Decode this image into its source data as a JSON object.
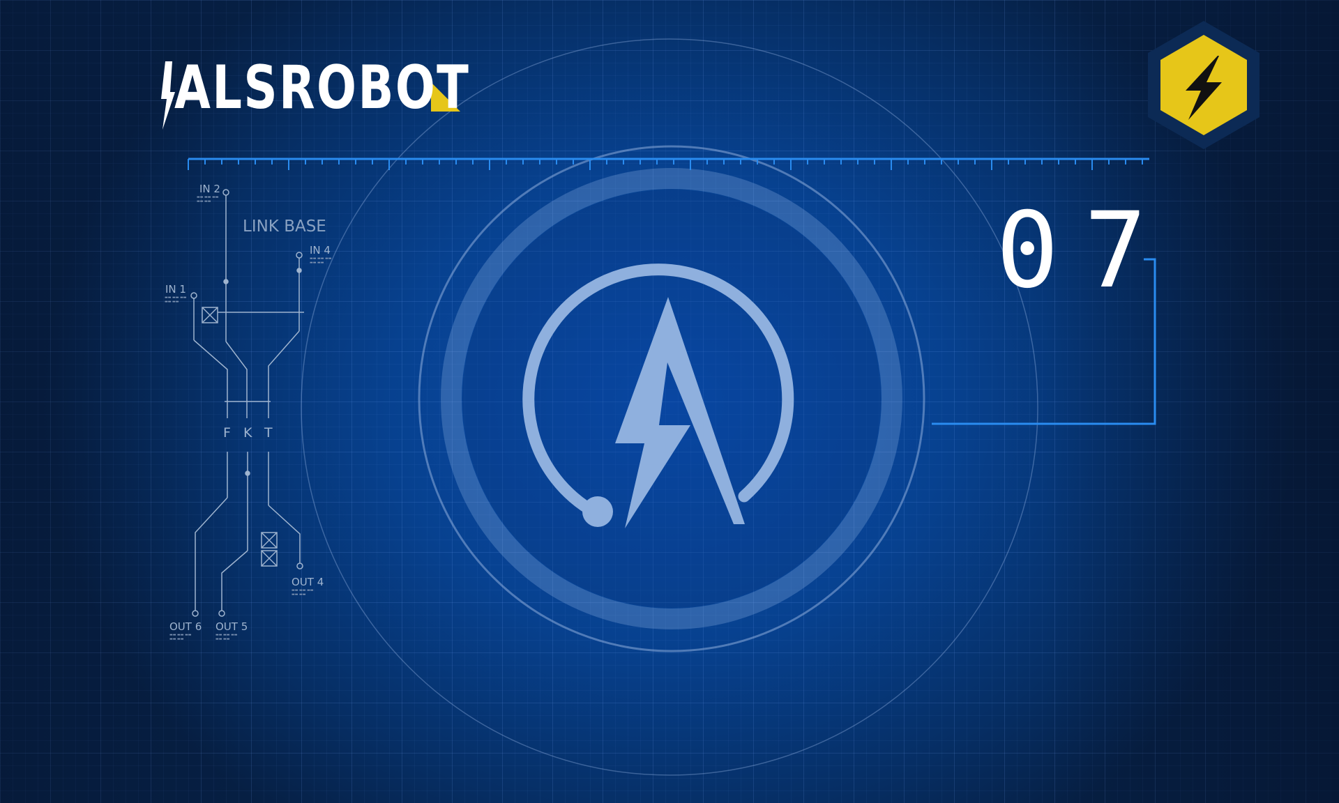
{
  "brand": {
    "name": "ALSROBOT"
  },
  "counter": {
    "value": "07"
  },
  "diagram": {
    "title": "LINK BASE",
    "pins": {
      "in2": "IN 2",
      "in4": "IN 4",
      "in1": "IN 1",
      "out4": "OUT 4",
      "out6": "OUT 6",
      "out5": "OUT 5"
    },
    "letters": [
      "F",
      "K",
      "T"
    ]
  },
  "colors": {
    "background": "#07418f",
    "accent_yellow": "#e6c619",
    "ruler_blue": "#2a8cf0",
    "logo_mark": "#8fb0de",
    "text_white": "#ffffff"
  },
  "icons": {
    "badge": "lightning-bolt-hexagon-icon",
    "logo": "circle-a-lightning-logo-icon"
  }
}
